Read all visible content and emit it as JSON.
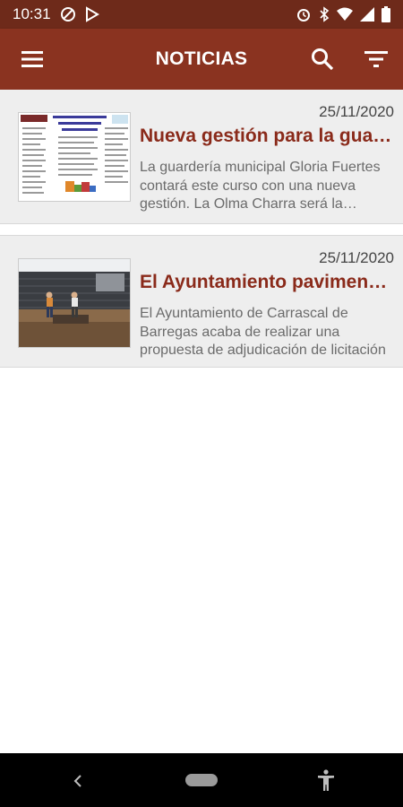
{
  "status_bar": {
    "time": "10:31",
    "left_icons": [
      "do-not-disturb-icon",
      "play-store-icon"
    ],
    "right_icons": [
      "alarm-icon",
      "bluetooth-icon",
      "wifi-icon",
      "signal-icon",
      "battery-icon"
    ]
  },
  "app_bar": {
    "title": "NOTICIAS",
    "menu_icon": "menu-icon",
    "search_icon": "search-icon",
    "filter_icon": "filter-icon",
    "color": "#8a3320"
  },
  "news": [
    {
      "date": "25/11/2020",
      "title": "Nueva gestión para la guardería municipal",
      "summary": "La guardería municipal Gloria Fuertes contará este curso con una nueva gestión. La Olma Charra será la encargada"
    },
    {
      "date": "25/11/2020",
      "title": "El Ayuntamiento pavimentará",
      "summary": "El Ayuntamiento de Carrascal de Barregas acaba de realizar una propuesta de adjudicación de licitación"
    }
  ],
  "nav_bar": {
    "back_icon": "back-icon",
    "home_icon": "home-pill-icon",
    "accessibility_icon": "accessibility-icon"
  }
}
